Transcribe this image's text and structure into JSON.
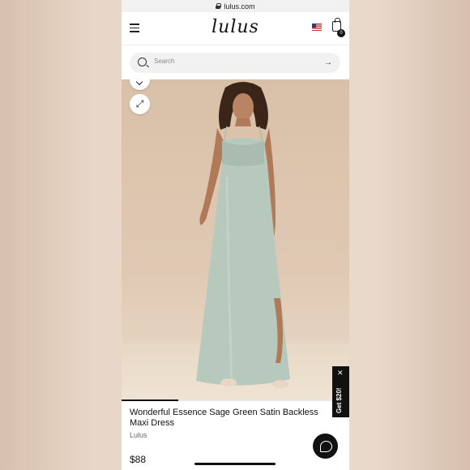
{
  "browser": {
    "url": "lulus.com"
  },
  "header": {
    "logo": "lulus",
    "bag_count": "0"
  },
  "search": {
    "placeholder": "Search"
  },
  "product": {
    "title": "Wonderful Essence Sage Green Satin Backless Maxi Dress",
    "brand": "Lulus",
    "price": "$88",
    "image_progress": 0.25
  },
  "promo": {
    "label": "Get $20!"
  },
  "icons": [
    "lock-icon",
    "menu-icon",
    "us-flag-icon",
    "shopping-bag-icon",
    "search-icon",
    "arrow-right-icon",
    "chevron-down-icon",
    "expand-icon",
    "close-icon",
    "chat-icon"
  ],
  "colors": {
    "dress": "#b7c9bc",
    "accent": "#111111",
    "background": "#e3cfbd"
  }
}
